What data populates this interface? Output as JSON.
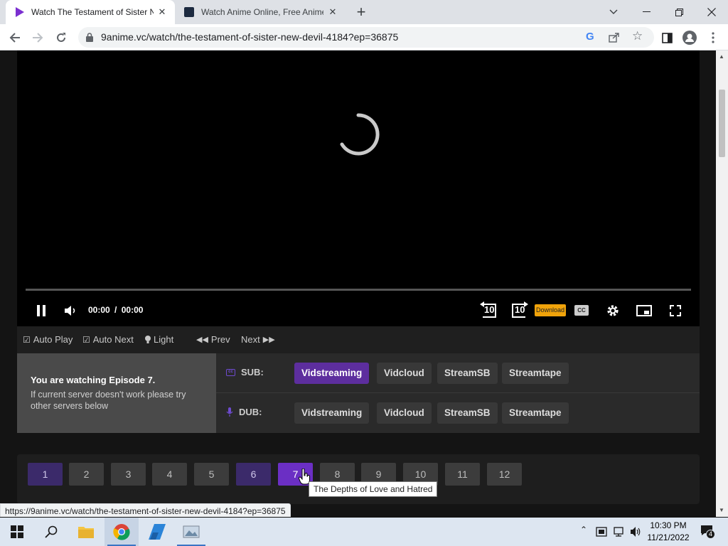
{
  "browser": {
    "tabs": [
      {
        "title": "Watch The Testament of Sister N",
        "active": true
      },
      {
        "title": "Watch Anime Online, Free Anime",
        "active": false
      }
    ],
    "url": "9anime.vc/watch/the-testament-of-sister-new-devil-4184?ep=36875",
    "status_url": "https://9anime.vc/watch/the-testament-of-sister-new-devil-4184?ep=36875"
  },
  "player": {
    "time_current": "00:00",
    "time_separator": "/",
    "time_total": "00:00",
    "skip_back": "10",
    "skip_forward": "10",
    "download_label": "Download",
    "cc_label": "CC"
  },
  "options": {
    "auto_play": "Auto Play",
    "auto_next": "Auto Next",
    "light": "Light",
    "prev": "Prev",
    "next": "Next"
  },
  "servers": {
    "watching_title": "You are watching Episode 7.",
    "watching_note": "If current server doesn't work please try other servers below",
    "sub_label": "SUB:",
    "dub_label": "DUB:",
    "sub": [
      "Vidstreaming",
      "Vidcloud",
      "StreamSB",
      "Streamtape"
    ],
    "dub": [
      "Vidstreaming",
      "Vidcloud",
      "StreamSB",
      "Streamtape"
    ],
    "selected_sub": "Vidstreaming"
  },
  "episodes": {
    "numbers": [
      "1",
      "2",
      "3",
      "4",
      "5",
      "6",
      "7",
      "8",
      "9",
      "10",
      "11",
      "12"
    ],
    "current": "7",
    "watched": [
      "1",
      "6"
    ],
    "tooltip": "The Depths of Love and Hatred"
  },
  "taskbar": {
    "time": "10:30 PM",
    "date": "11/21/2022",
    "notifications": "4"
  },
  "colors": {
    "accent": "#5d2e9e",
    "episode_current": "#6b2fc4",
    "download_badge": "#f0a30a"
  }
}
